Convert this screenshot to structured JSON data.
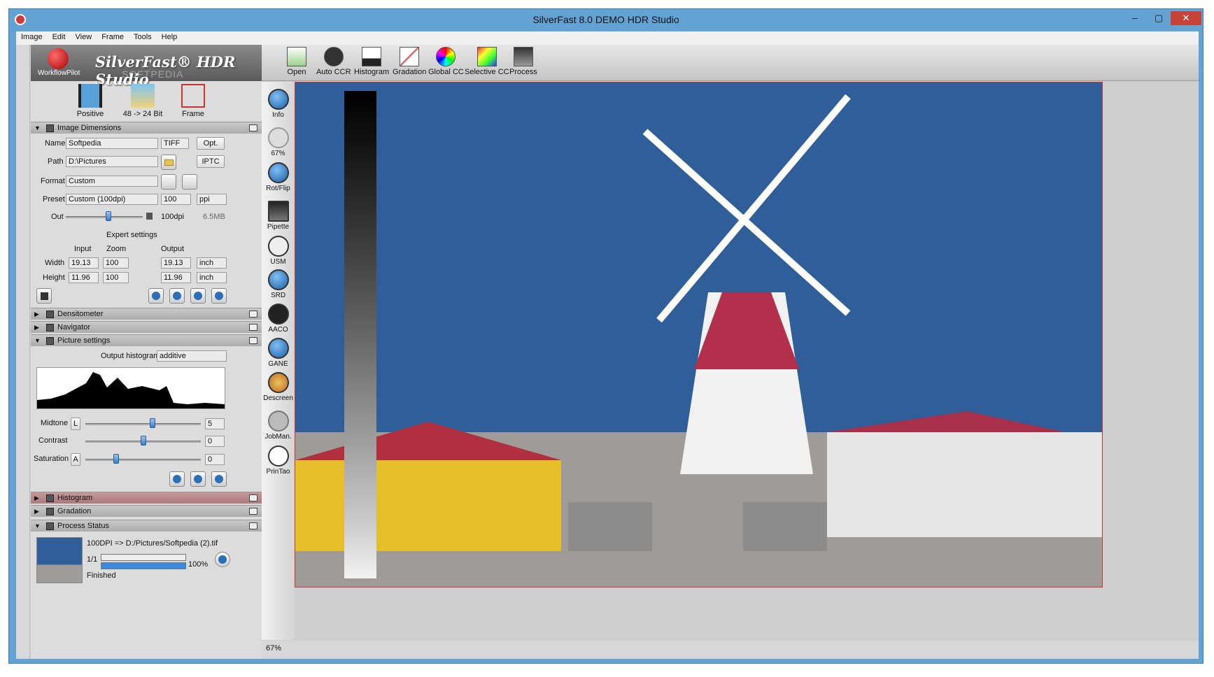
{
  "window": {
    "title": "SilverFast 8.0 DEMO  HDR Studio",
    "min": "–",
    "max": "▢",
    "close": "✕"
  },
  "menu": [
    "Image",
    "Edit",
    "View",
    "Frame",
    "Tools",
    "Help"
  ],
  "logo": {
    "text": "SilverFast® HDR Studio",
    "sub": "WorkflowPilot",
    "watermark": "SOFTPEDIA"
  },
  "topicons": [
    {
      "label": "Positive"
    },
    {
      "label": "48 -> 24 Bit"
    },
    {
      "label": "Frame"
    }
  ],
  "dims": {
    "section": "Image Dimensions",
    "name_label": "Name",
    "name": "Softpedia",
    "filetype": "TIFF",
    "opt": "Opt.",
    "path_label": "Path",
    "path": "D:\\Pictures",
    "iptc": "IPTC",
    "format_label": "Format",
    "format": "Custom",
    "preset_label": "Preset",
    "preset": "Custom (100dpi)",
    "preset_val": "100",
    "unit": "ppi",
    "out_label": "Out",
    "out_val": "100dpi",
    "size": "6.5MB",
    "expert": "Expert settings",
    "input": "Input",
    "zoom": "Zoom",
    "output": "Output",
    "width_label": "Width",
    "width_in": "19.13",
    "width_zoom": "100",
    "width_out": "19.13",
    "width_unit": "inch",
    "height_label": "Height",
    "height_in": "11.96",
    "height_zoom": "100",
    "height_out": "11.96",
    "height_unit": "inch",
    "out_slider": 0.55
  },
  "sections": {
    "densitometer": "Densitometer",
    "navigator": "Navigator",
    "picture": "Picture settings",
    "histogram": "Histogram",
    "gradation": "Gradation",
    "process": "Process Status"
  },
  "picture": {
    "hist_label": "Output histogram",
    "hist_mode": "additive",
    "midtone_label": "Midtone",
    "midtone_btn": "L",
    "midtone": "5",
    "contrast_label": "Contrast",
    "contrast": "0",
    "saturation_label": "Saturation",
    "saturation_btn": "A",
    "saturation": "0"
  },
  "process": {
    "line": "100DPI => D:/Pictures/Softpedia (2).tif",
    "count": "1/1",
    "percent": "100%",
    "state": "Finished",
    "progress": 1.0
  },
  "toolbar": [
    {
      "label": "Open"
    },
    {
      "label": "Auto CCR"
    },
    {
      "label": "Histogram"
    },
    {
      "label": "Gradation"
    },
    {
      "label": "Global CC"
    },
    {
      "label": "Selective CC"
    },
    {
      "label": "Process"
    }
  ],
  "vtools": [
    {
      "label": "Info"
    },
    {
      "label": "67%"
    },
    {
      "label": "Rot/Flip"
    },
    {
      "label": "Pipette"
    },
    {
      "label": "USM"
    },
    {
      "label": "SRD"
    },
    {
      "label": "AACO"
    },
    {
      "label": "GANE"
    },
    {
      "label": "Descreen"
    },
    {
      "label": "JobMan."
    },
    {
      "label": "PrinTao"
    }
  ],
  "status": {
    "zoom": "67%"
  }
}
